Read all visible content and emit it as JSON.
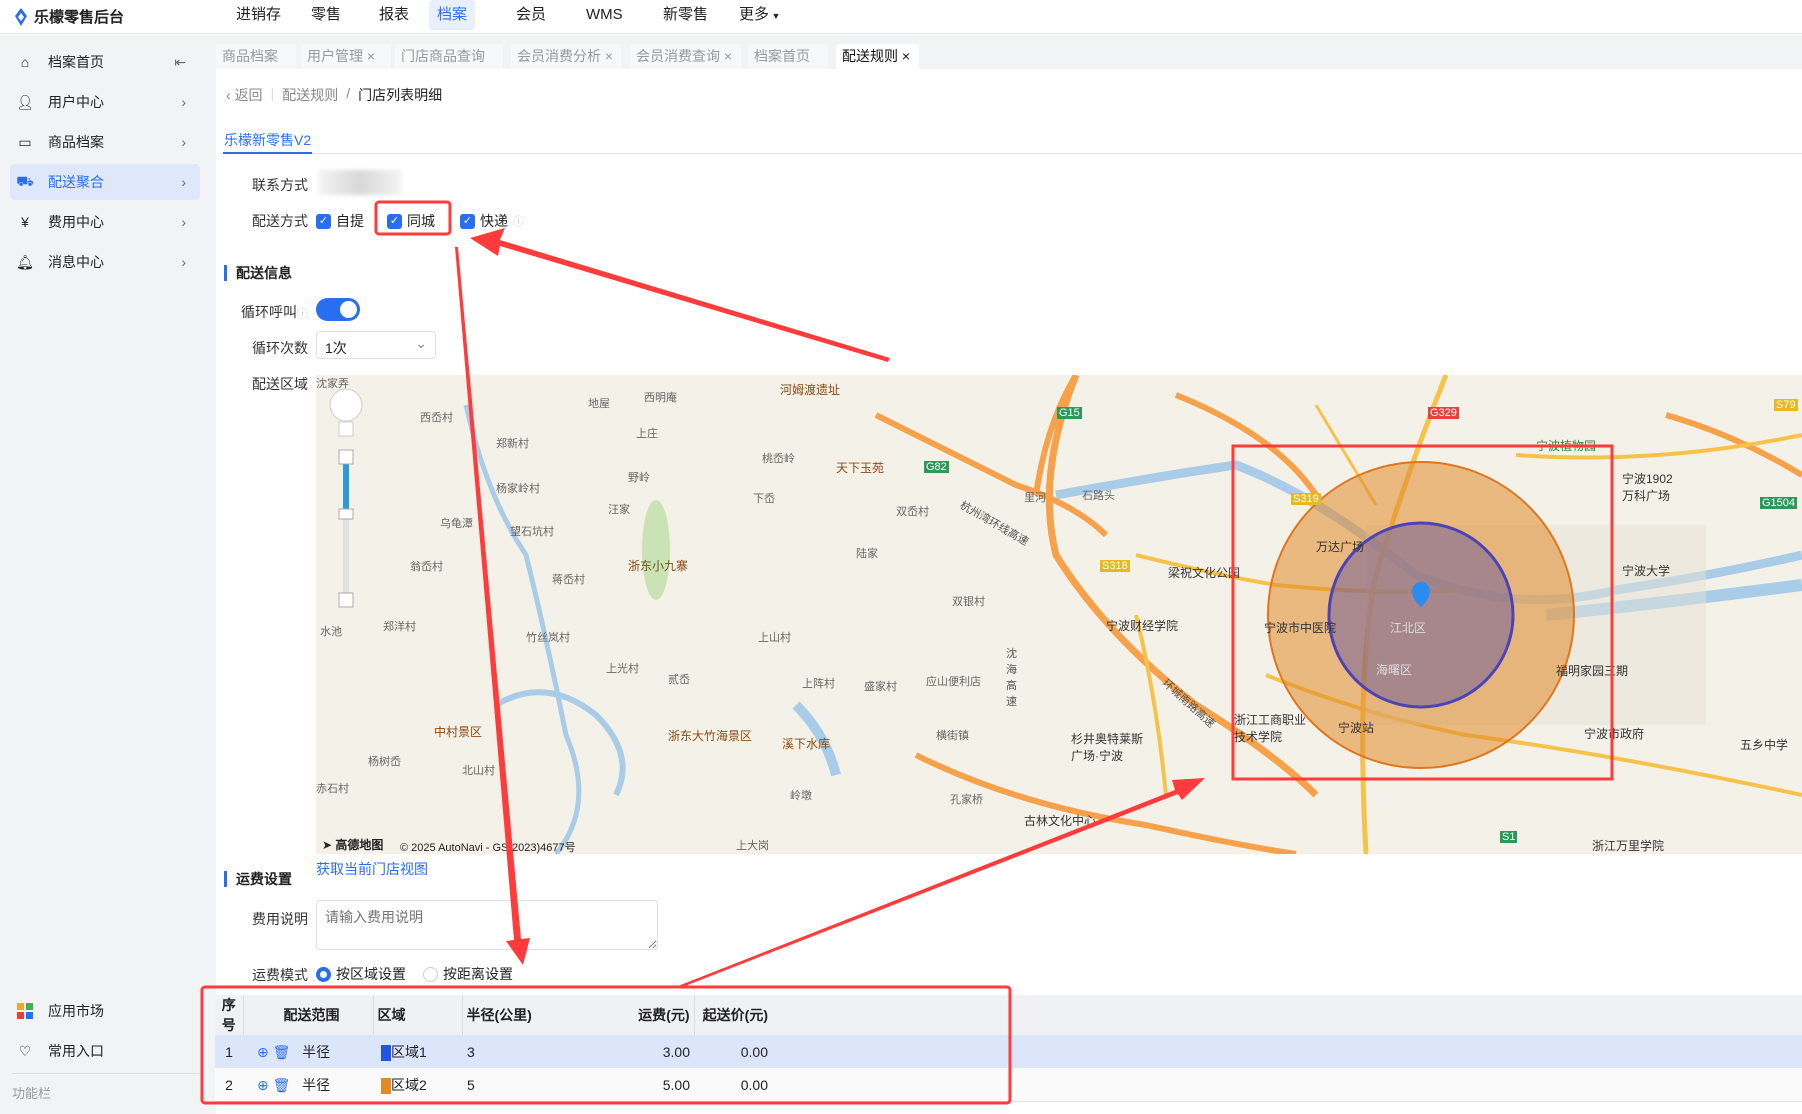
{
  "app": {
    "title": "乐檬零售后台"
  },
  "nav": [
    "进销存",
    "零售",
    "报表",
    "档案",
    "会员",
    "WMS",
    "新零售",
    "更多"
  ],
  "sidebar": {
    "items": [
      "档案首页",
      "用户中心",
      "商品档案",
      "配送聚合",
      "费用中心",
      "消息中心"
    ],
    "bottom": [
      "应用市场",
      "常用入口"
    ],
    "footer": "功能栏"
  },
  "tabs": [
    "商品档案",
    "用户管理",
    "门店商品查询",
    "会员消费分析",
    "会员消费查询",
    "档案首页",
    "配送规则"
  ],
  "breadcrumb": {
    "back": "返回",
    "parent": "配送规则",
    "current": "门店列表明细"
  },
  "store_tab": "乐檬新零售V2",
  "form": {
    "contact_label": "联系方式",
    "delivery_label": "配送方式",
    "delivery_options": [
      "自提",
      "同城",
      "快递"
    ],
    "section_delivery": "配送信息",
    "loop_call_label": "循环呼叫",
    "loop_call_on": true,
    "loop_count_label": "循环次数",
    "loop_count_value": "1次",
    "area_label": "配送区域",
    "get_view_link": "获取当前门店视图",
    "section_fee": "运费设置",
    "fee_desc_label": "费用说明",
    "fee_desc_placeholder": "请输入费用说明",
    "fee_mode_label": "运费模式",
    "fee_modes": [
      "按区域设置",
      "按距离设置"
    ],
    "fee_mode_selected": "按区域设置"
  },
  "map": {
    "attribution": "高德地图",
    "copyright": "© 2025 AutoNavi - GS(2023)4677号",
    "labels": [
      "河姆渡遗址",
      "天下玉苑",
      "浙东小九寨",
      "中村景区",
      "浙东大竹海景区",
      "溪下水库",
      "梁祝文化公园",
      "宁波财经学院",
      "宁波市中医院",
      "万达广场",
      "江北区",
      "海曙区",
      "宁波站",
      "浙江工商职业技术学院",
      "福明家园三期",
      "宁波大学",
      "宁波1902万科广场",
      "宁波市政府",
      "五乡中学",
      "浙江万里学院",
      "杉井奥特莱斯广场·宁波",
      "古林文化中心",
      "宁波植物园",
      "杭州湾环线高速",
      "环城南路高速",
      "沈海高速"
    ],
    "villages": [
      "沈家弄",
      "西岙村",
      "郑新村",
      "杨家岭村",
      "乌龟潭",
      "望石坑村",
      "翁岙村",
      "郑洋村",
      "竹丝岚村",
      "蒋岙村",
      "上庄",
      "野岭",
      "汪家",
      "下岙",
      "桃岙岭",
      "上山村",
      "上光村",
      "贰岙",
      "上阵村",
      "盛家村",
      "应山便利店",
      "横街镇",
      "岭墩",
      "孔家桥",
      "双银村",
      "陆家",
      "地屋",
      "西明庵",
      "上大岗",
      "北山村",
      "杨树岙",
      "赤石村",
      "水池",
      "双岙村",
      "里河",
      "石路头"
    ],
    "roads": [
      "G15",
      "G82",
      "S318",
      "S319",
      "G329",
      "S79",
      "G1504",
      "S1"
    ]
  },
  "table": {
    "headers": [
      "序号",
      "配送范围",
      "区域",
      "半径(公里)",
      "运费(元)",
      "起送价(元)"
    ],
    "rows": [
      {
        "no": "1",
        "range": "半径",
        "area": "区域1",
        "color": "#2255dd",
        "radius": "3",
        "fee": "3.00",
        "min": "0.00"
      },
      {
        "no": "2",
        "range": "半径",
        "area": "区域2",
        "color": "#e08a2a",
        "radius": "5",
        "fee": "5.00",
        "min": "0.00"
      }
    ]
  },
  "colors": {
    "accent": "#2a6ef0",
    "annotation": "#ff3b3b"
  }
}
